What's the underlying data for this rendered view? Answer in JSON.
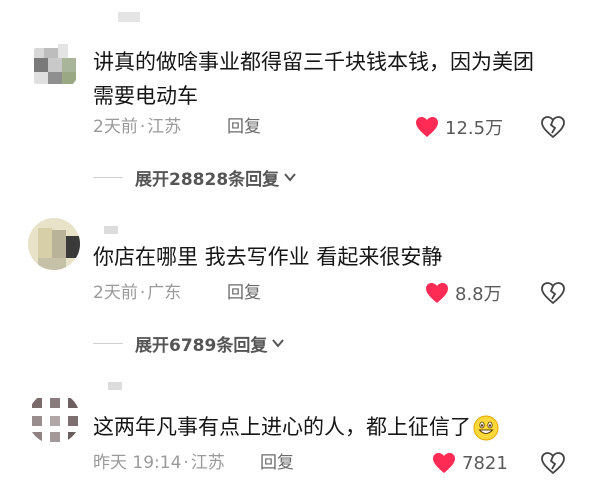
{
  "comments": [
    {
      "text": "讲真的做啥事业都得留三千块钱本钱，因为美团需要电动车",
      "time": "2天前",
      "location": "江苏",
      "reply_label": "回复",
      "likes": "12.5万",
      "expand_label": "展开28828条回复"
    },
    {
      "text": "你店在哪里 我去写作业 看起来很安静",
      "time": "2天前",
      "location": "广东",
      "reply_label": "回复",
      "likes": "8.8万",
      "expand_label": "展开6789条回复"
    },
    {
      "text": "这两年凡事有点上进心的人，都上征信了",
      "emoji": "grinning-face-emoji",
      "time": "昨天 19:14",
      "location": "江苏",
      "reply_label": "回复",
      "likes": "7821"
    }
  ],
  "meta_separator": "·",
  "colors": {
    "heart": "#fe2c55",
    "meta_text": "#9a9a9a",
    "body_text": "#161616"
  },
  "icons": {
    "like": "heart-filled-icon",
    "dislike": "broken-heart-icon",
    "expand": "chevron-down-icon"
  }
}
